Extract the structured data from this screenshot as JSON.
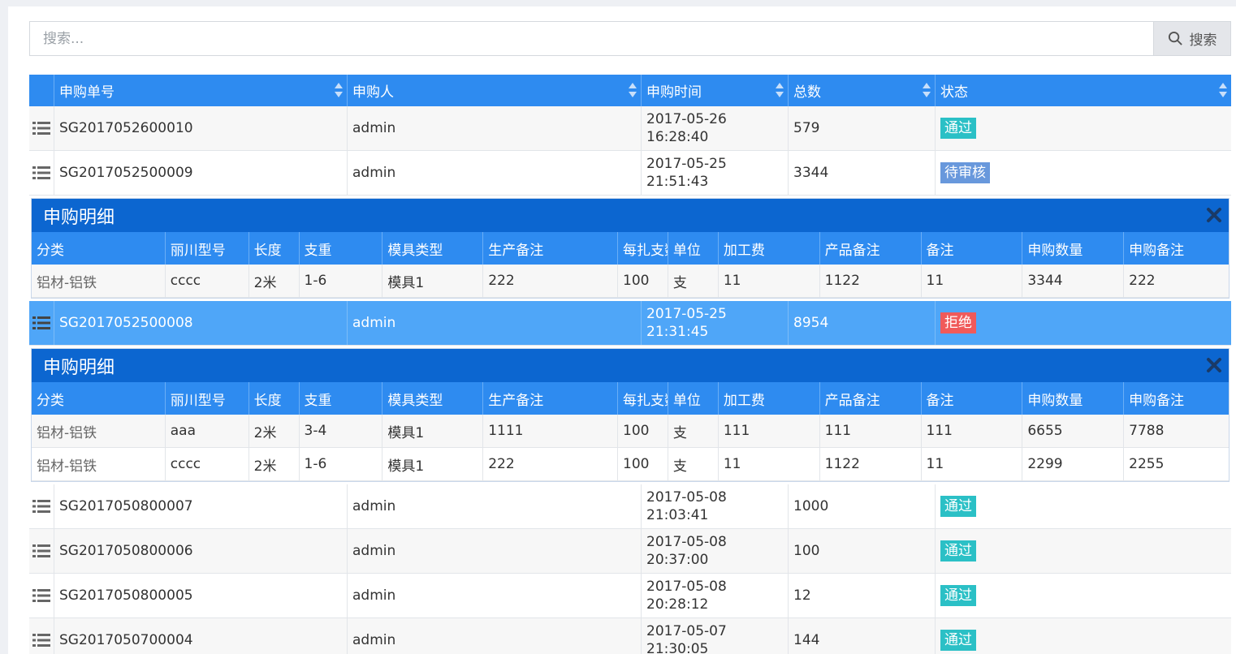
{
  "search": {
    "placeholder": "搜索...",
    "button_label": "搜索"
  },
  "grid": {
    "columns": [
      "申购单号",
      "申购人",
      "申购时间",
      "总数",
      "状态"
    ],
    "rows": [
      {
        "id": "SG2017052600010",
        "user": "admin",
        "date": "2017-05-26",
        "time": "16:28:40",
        "total": "579",
        "status": "通过"
      },
      {
        "id": "SG2017052500009",
        "user": "admin",
        "date": "2017-05-25",
        "time": "21:51:43",
        "total": "3344",
        "status": "待审核"
      },
      {
        "id": "SG2017052500008",
        "user": "admin",
        "date": "2017-05-25",
        "time": "21:31:45",
        "total": "8954",
        "status": "拒绝"
      },
      {
        "id": "SG2017050800007",
        "user": "admin",
        "date": "2017-05-08",
        "time": "21:03:41",
        "total": "1000",
        "status": "通过"
      },
      {
        "id": "SG2017050800006",
        "user": "admin",
        "date": "2017-05-08",
        "time": "20:37:00",
        "total": "100",
        "status": "通过"
      },
      {
        "id": "SG2017050800005",
        "user": "admin",
        "date": "2017-05-08",
        "time": "20:28:12",
        "total": "12",
        "status": "通过"
      },
      {
        "id": "SG2017050700004",
        "user": "admin",
        "date": "2017-05-07",
        "time": "21:30:05",
        "total": "144",
        "status": "通过"
      }
    ]
  },
  "detail": {
    "title": "申购明细",
    "columns": [
      "分类",
      "丽川型号",
      "长度",
      "支重",
      "模具类型",
      "生产备注",
      "每扎支数",
      "单位",
      "加工费",
      "产品备注",
      "备注",
      "申购数量",
      "申购备注"
    ],
    "panel1": [
      [
        "铝材-铝铁",
        "cccc",
        "2米",
        "1-6",
        "模具1",
        "222",
        "100",
        "支",
        "11",
        "1122",
        "11",
        "3344",
        "222"
      ]
    ],
    "panel2": [
      [
        "铝材-铝铁",
        "aaa",
        "2米",
        "3-4",
        "模具1",
        "1111",
        "100",
        "支",
        "111",
        "111",
        "111",
        "6655",
        "7788"
      ],
      [
        "铝材-铝铁",
        "cccc",
        "2米",
        "1-6",
        "模具1",
        "222",
        "100",
        "支",
        "11",
        "1122",
        "11",
        "2299",
        "2255"
      ]
    ]
  },
  "colors": {
    "header": "#2e8bf0",
    "detail_title": "#0c66d0",
    "selected_row": "#4fa6f8",
    "pass": "#2bc0c6",
    "pending": "#6898dc",
    "reject": "#f05a5a"
  }
}
